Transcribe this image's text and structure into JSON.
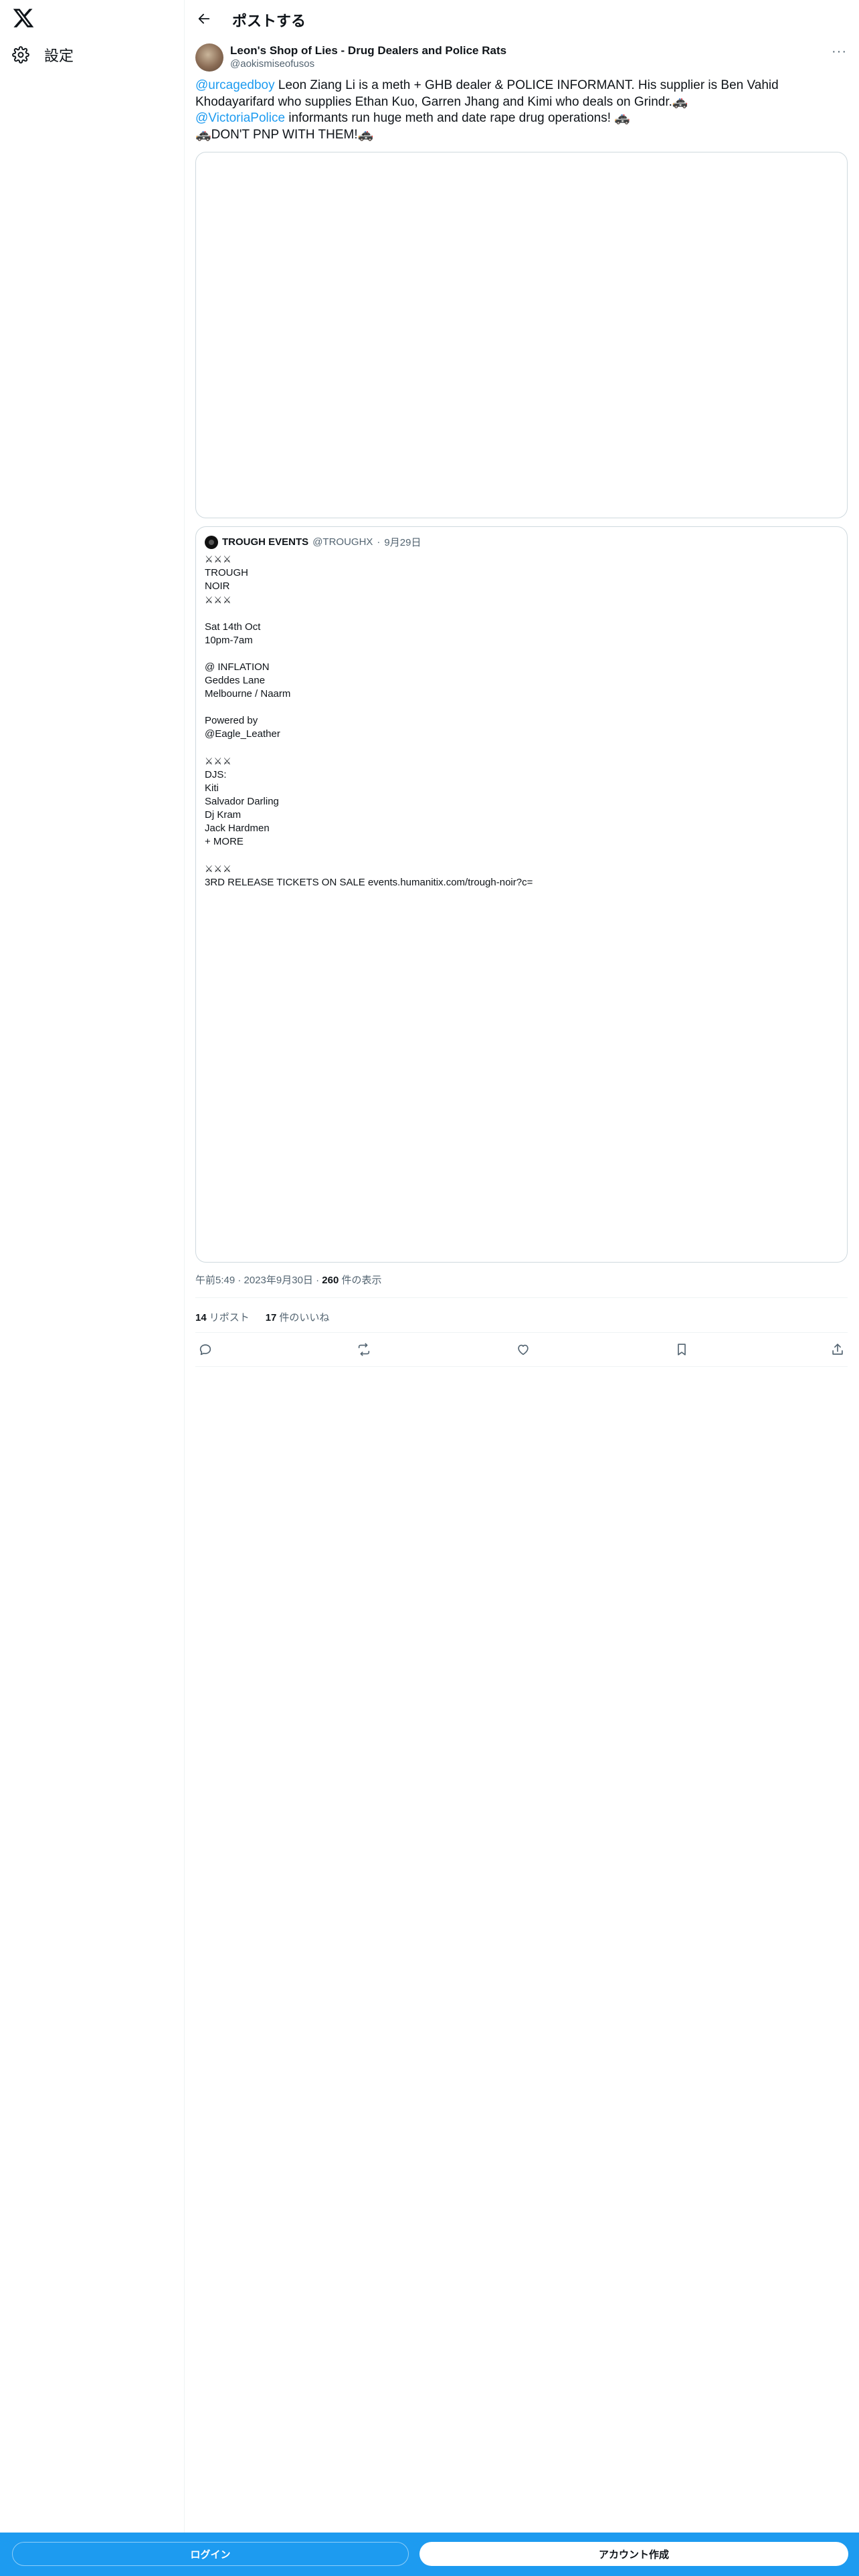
{
  "sidebar": {
    "settings_label": "設定"
  },
  "header": {
    "title": "ポストする"
  },
  "post": {
    "author_name": "Leon's Shop of Lies - Drug Dealers and Police Rats",
    "author_handle": "@aokismiseofusos",
    "mention_1": "@urcagedboy",
    "text_1": " Leon Ziang Li is a meth + GHB dealer & POLICE INFORMANT. His supplier is Ben Vahid Khodayarifard who supplies Ethan Kuo, Garren Jhang and Kimi who deals on Grindr.🚓",
    "mention_2": "@VictoriaPolice",
    "text_2": " informants run huge meth and date rape drug operations! 🚓",
    "text_3": "🚓DON'T PNP WITH THEM!🚓",
    "more_label": "···"
  },
  "quote": {
    "name": "TROUGH EVENTS",
    "handle": "@TROUGHX",
    "separator": "·",
    "date": "9月29日",
    "swords": "⚔⚔⚔",
    "block_1": "TROUGH\nNOIR",
    "block_2": "Sat 14th Oct\n10pm-7am\n\n@ INFLATION\nGeddes Lane\nMelbourne / Naarm\n\nPowered by\n@Eagle_Leather",
    "block_3": "DJS:\nKiti\nSalvador Darling\nDj Kram\nJack Hardmen\n+ MORE",
    "block_4": "3RD RELEASE TICKETS ON SALE events.humanitix.com/trough-noir?c="
  },
  "meta": {
    "time": "午前5:49 · 2023年9月30日 · ",
    "views_count": "260",
    "views_label": " 件の表示",
    "reposts_count": "14",
    "reposts_label": "リポスト",
    "likes_count": "17",
    "likes_label": "件のいいね"
  },
  "bottom": {
    "login_label": "ログイン",
    "signup_label": "アカウント作成"
  },
  "icons": {
    "logo": "x-logo-icon",
    "settings": "gear-icon",
    "back": "arrow-left-icon",
    "reply": "reply-icon",
    "repost": "repost-icon",
    "like": "heart-icon",
    "bookmark": "bookmark-icon",
    "share": "share-icon"
  },
  "colors": {
    "accent": "#1d9bf0",
    "text": "#0f1419",
    "muted": "#536471",
    "border": "#cfd9de"
  }
}
